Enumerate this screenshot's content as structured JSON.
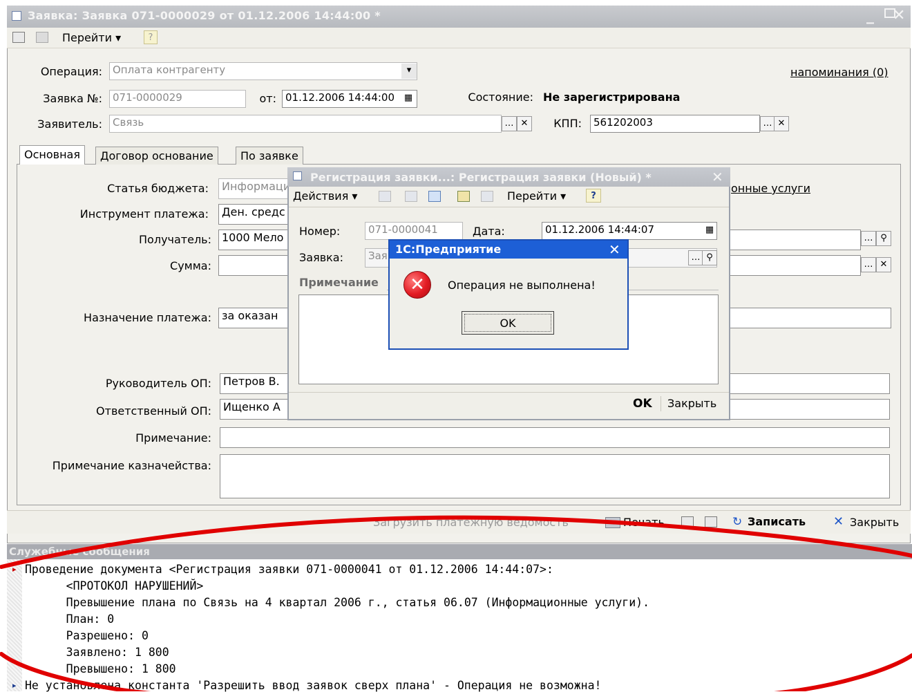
{
  "main_window": {
    "title": "Заявка: Заявка 071-0000029 от 01.12.2006 14:44:00 *",
    "toolbar": {
      "goto_label": "Перейти ▾",
      "help_label": "?"
    },
    "reminders_link": "напоминания (0)",
    "operation": {
      "label": "Операция:",
      "value": "Оплата контрагенту"
    },
    "request_no": {
      "label": "Заявка №:",
      "value": "071-0000029"
    },
    "date": {
      "label": "от:",
      "value": "01.12.2006 14:44:00"
    },
    "state": {
      "label": "Состояние:",
      "value": "Не зарегистрирована"
    },
    "applicant": {
      "label": "Заявитель:",
      "value": "Связь"
    },
    "kpp": {
      "label": "КПП:",
      "value": "561202003"
    },
    "tabs": [
      {
        "label": "Основная"
      },
      {
        "label": "Договор основание"
      },
      {
        "label": "По заявке"
      }
    ],
    "form": {
      "budget_item": {
        "label": "Статья бюджета:",
        "value": "Информаци"
      },
      "budget_link": "онные услуги",
      "payment_tool": {
        "label": "Инструмент платежа:",
        "value": "Ден. средс"
      },
      "recipient": {
        "label": "Получатель:",
        "value": "1000 Мело"
      },
      "amount": {
        "label": "Сумма:",
        "value": ""
      },
      "purpose": {
        "label": "Назначение платежа:",
        "value": "за оказан"
      },
      "head_op": {
        "label": "Руководитель ОП:",
        "value": "Петров В."
      },
      "resp_op": {
        "label": "Ответственный ОП:",
        "value": "Ищенко А"
      },
      "note": {
        "label": "Примечание:",
        "value": ""
      },
      "treasury_note": {
        "label": "Примечание казначейства:",
        "value": ""
      }
    },
    "bottom_bar": {
      "load_label": "Загрузить платежную ведомость",
      "print_label": "Печать",
      "save_label": "Записать",
      "close_label": "Закрыть"
    }
  },
  "registration_dialog": {
    "title": "Регистрация заявки...: Регистрация заявки (Новый) *",
    "actions_label": "Действия ▾",
    "goto_label": "Перейти ▾",
    "help_label": "?",
    "number": {
      "label": "Номер:",
      "value": "071-0000041"
    },
    "date": {
      "label": "Дата:",
      "value": "01.12.2006 14:44:07"
    },
    "request": {
      "label": "Заявка:",
      "value": "Зая"
    },
    "note_label": "Примечание",
    "ok_label": "OK",
    "close_label": "Закрыть"
  },
  "message_box": {
    "title": "1С:Предприятие",
    "text": "Операция не выполнена!",
    "ok_label": "OK"
  },
  "service_messages": {
    "header": "Служебные сообщения",
    "lines": [
      "Проведение документа <Регистрация заявки 071-0000041 от 01.12.2006 14:44:07>:",
      "     <ПРОТОКОЛ НАРУШЕНИЙ>",
      "     Превышение плана по Связь на 4 квартал 2006 г., статья 06.07 (Информационные услуги).",
      "     План: 0",
      "     Разрешено: 0",
      "     Заявлено: 1 800",
      "     Превышено: 1 800",
      "Не установлена константа 'Разрешить ввод заявок сверх плана' - Операция не возможна!"
    ]
  },
  "colors": {
    "error_red": "#e31b23",
    "msgbox_blue": "#1d5fd6",
    "annotation_red": "#e00000"
  }
}
